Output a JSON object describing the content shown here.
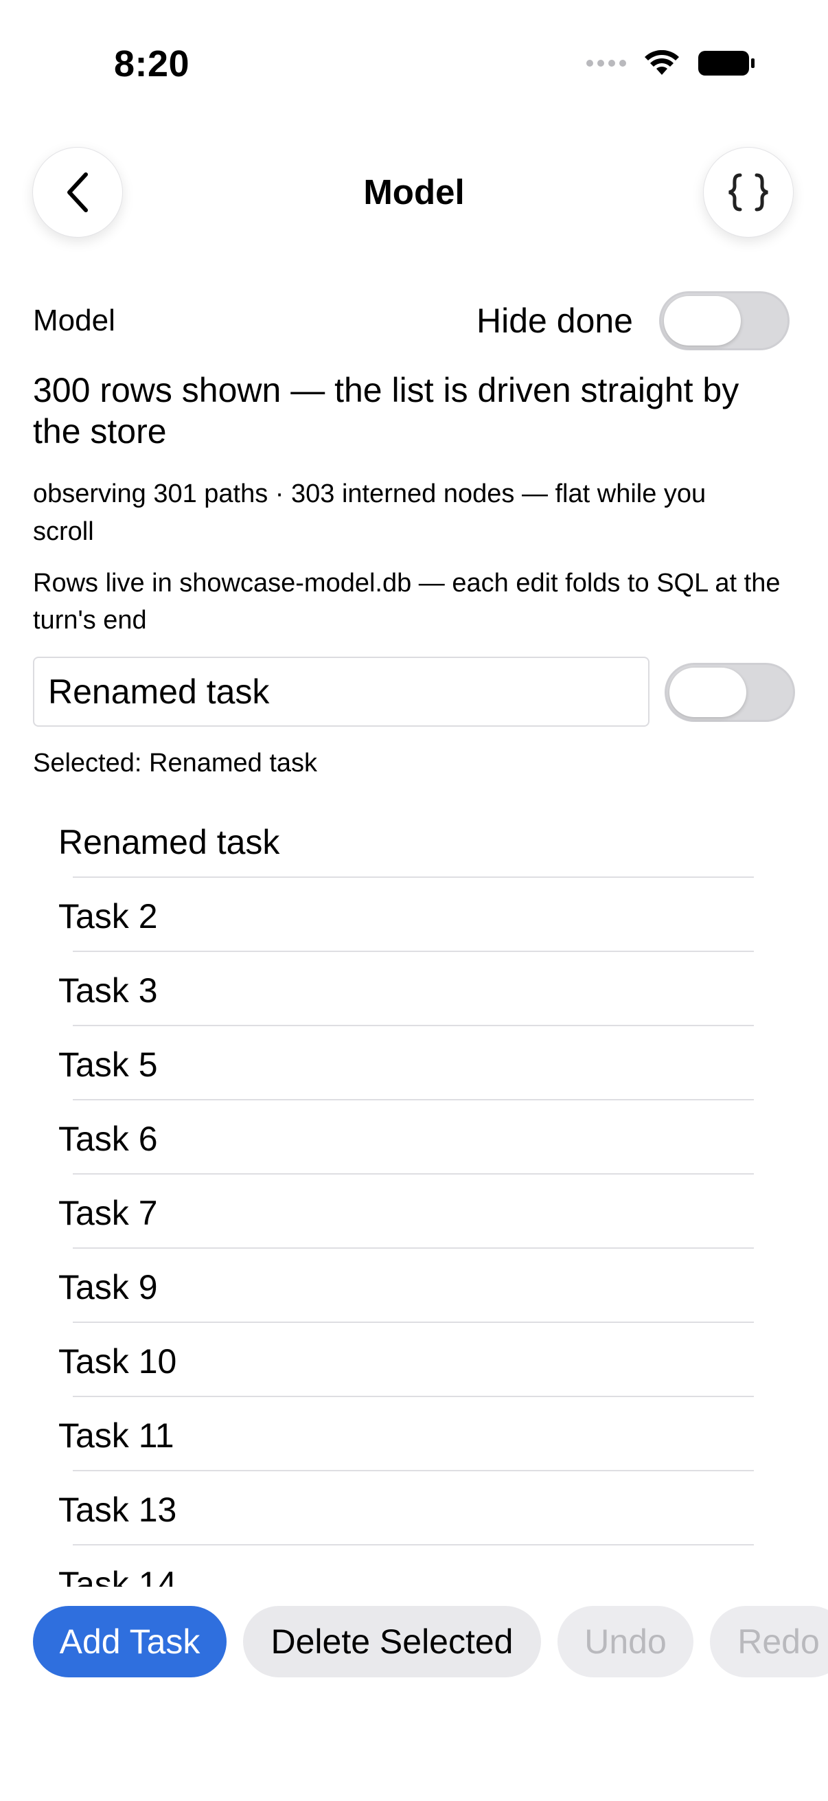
{
  "status_bar": {
    "time": "8:20"
  },
  "nav": {
    "title": "Model",
    "back_icon": "chevron-left-icon",
    "json_icon": "curly-braces-icon"
  },
  "header": {
    "model_label": "Model",
    "hide_done_label": "Hide done",
    "hide_done_on": false
  },
  "info": {
    "headline": "300 rows shown — the list is driven straight by the store",
    "observing": "observing 301 paths · 303 interned nodes — flat while you scroll",
    "rows_live": "Rows live in showcase-model.db — each edit folds to SQL at the turn's end"
  },
  "editor": {
    "value": "Renamed task",
    "done_on": false
  },
  "selected": "Selected: Renamed task",
  "tasks": [
    {
      "label": "Renamed task"
    },
    {
      "label": "Task 2"
    },
    {
      "label": "Task 3"
    },
    {
      "label": "Task 5"
    },
    {
      "label": "Task 6"
    },
    {
      "label": "Task 7"
    },
    {
      "label": "Task 9"
    },
    {
      "label": "Task 10"
    },
    {
      "label": "Task 11"
    },
    {
      "label": "Task 13"
    },
    {
      "label": "Task 14"
    }
  ],
  "actions": {
    "add": "Add Task",
    "delete": "Delete Selected",
    "undo": "Undo",
    "redo": "Redo"
  },
  "colors": {
    "accent": "#2f6fde",
    "disabled_text": "#b9b9bd"
  }
}
